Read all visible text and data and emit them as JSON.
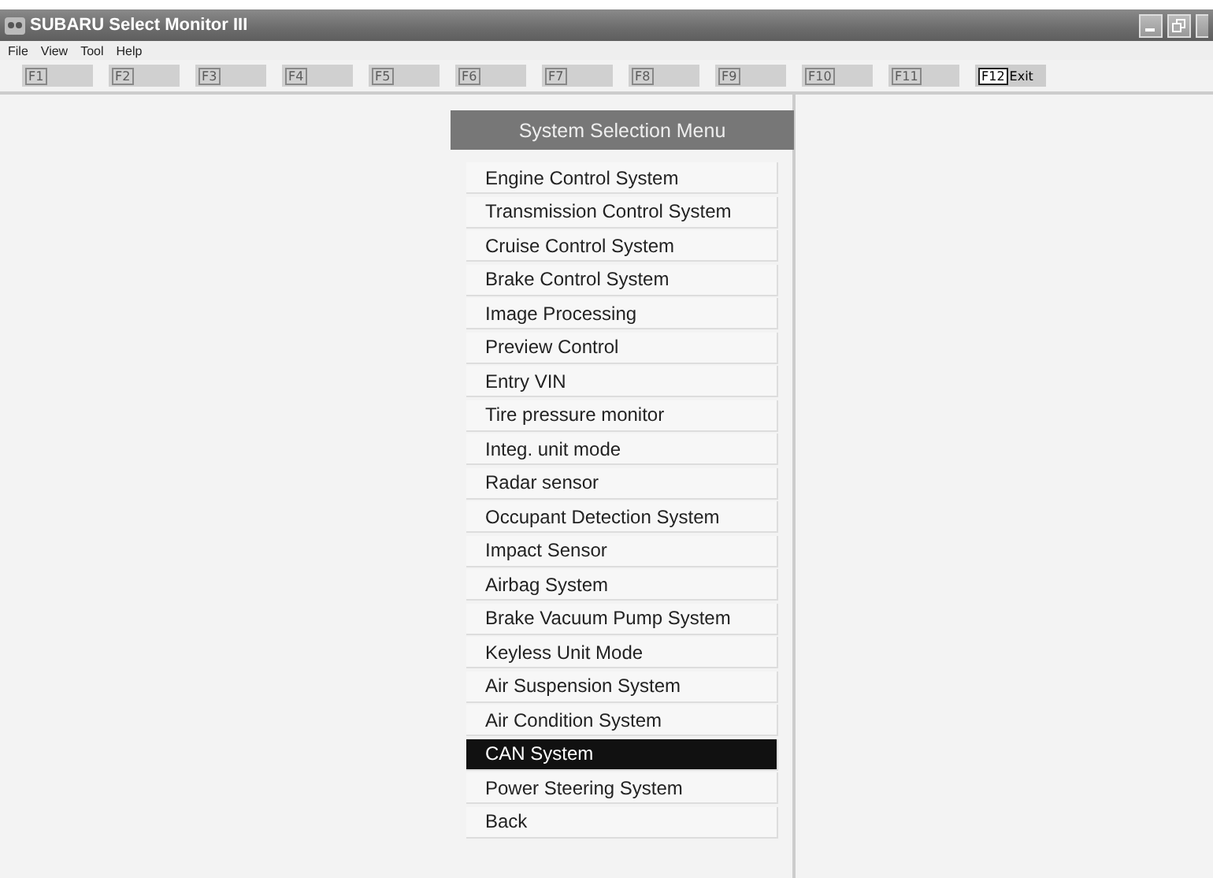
{
  "window": {
    "title": "SUBARU Select Monitor III"
  },
  "menu_bar": [
    "File",
    "View",
    "Tool",
    "Help"
  ],
  "function_keys": [
    {
      "key": "F1",
      "disabled": true
    },
    {
      "key": "F2",
      "disabled": true
    },
    {
      "key": "F3",
      "disabled": true
    },
    {
      "key": "F4",
      "disabled": true
    },
    {
      "key": "F5",
      "disabled": true
    },
    {
      "key": "F6",
      "disabled": true
    },
    {
      "key": "F7",
      "disabled": true
    },
    {
      "key": "F8",
      "disabled": true
    },
    {
      "key": "F9",
      "disabled": true
    },
    {
      "key": "F10",
      "disabled": true
    },
    {
      "key": "F11",
      "disabled": true
    },
    {
      "key": "F12",
      "label": "Exit",
      "disabled": false
    }
  ],
  "system_menu": {
    "title": "System Selection Menu",
    "items": [
      {
        "label": "Engine Control System",
        "selected": false
      },
      {
        "label": "Transmission Control System",
        "selected": false
      },
      {
        "label": "Cruise Control System",
        "selected": false
      },
      {
        "label": "Brake Control System",
        "selected": false
      },
      {
        "label": "Image Processing",
        "selected": false
      },
      {
        "label": "Preview Control",
        "selected": false
      },
      {
        "label": "Entry VIN",
        "selected": false
      },
      {
        "label": "Tire pressure monitor",
        "selected": false
      },
      {
        "label": "Integ. unit mode",
        "selected": false
      },
      {
        "label": "Radar sensor",
        "selected": false
      },
      {
        "label": "Occupant Detection System",
        "selected": false
      },
      {
        "label": "Impact Sensor",
        "selected": false
      },
      {
        "label": "Airbag System",
        "selected": false
      },
      {
        "label": "Brake Vacuum Pump System",
        "selected": false
      },
      {
        "label": "Keyless Unit Mode",
        "selected": false
      },
      {
        "label": "Air Suspension System",
        "selected": false
      },
      {
        "label": "Air Condition System",
        "selected": false
      },
      {
        "label": "CAN System",
        "selected": true
      },
      {
        "label": "Power Steering System",
        "selected": false
      },
      {
        "label": "Back",
        "selected": false
      }
    ]
  }
}
